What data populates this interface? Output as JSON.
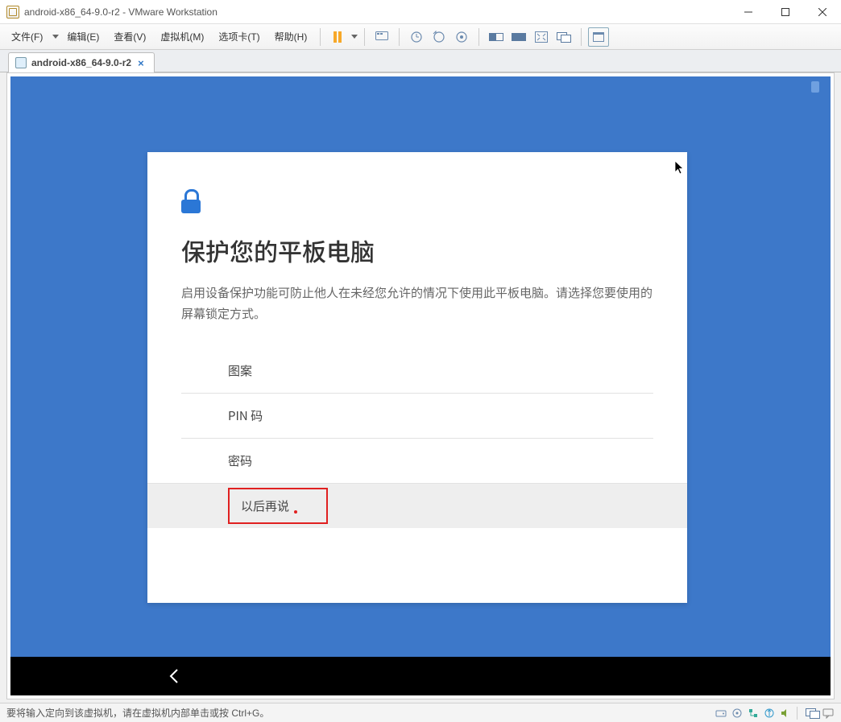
{
  "window": {
    "title": "android-x86_64-9.0-r2 - VMware Workstation"
  },
  "menu": {
    "file": "文件(F)",
    "edit": "编辑(E)",
    "view": "查看(V)",
    "vm": "虚拟机(M)",
    "tabs": "选项卡(T)",
    "help": "帮助(H)"
  },
  "tab": {
    "label": "android-x86_64-9.0-r2"
  },
  "android": {
    "title": "保护您的平板电脑",
    "description": "启用设备保护功能可防止他人在未经您允许的情况下使用此平板电脑。请选择您要使用的屏幕锁定方式。",
    "options": {
      "pattern": "图案",
      "pin": "PIN 码",
      "password": "密码",
      "later": "以后再说"
    }
  },
  "statusbar": {
    "hint": "要将输入定向到该虚拟机，请在虚拟机内部单击或按 Ctrl+G。"
  }
}
